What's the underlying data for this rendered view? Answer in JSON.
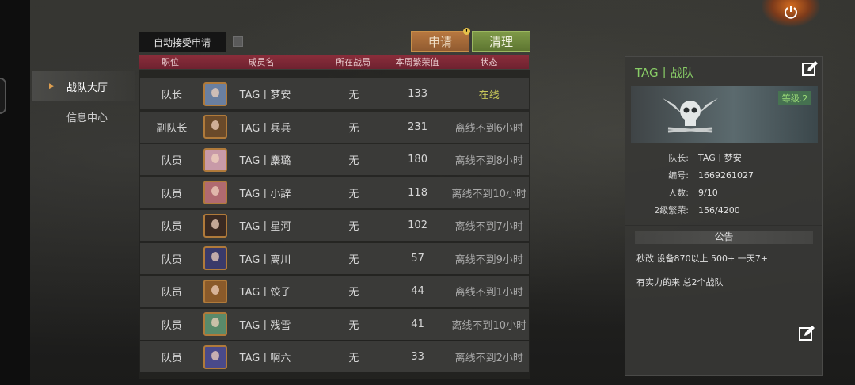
{
  "nav": {
    "items": [
      {
        "label": "战队大厅",
        "active": true
      },
      {
        "label": "信息中心",
        "active": false
      }
    ]
  },
  "toolbar": {
    "auto_accept_label": "自动接受申请",
    "apply_label": "申请",
    "apply_badge": "!",
    "clear_label": "清理"
  },
  "table": {
    "headers": [
      "职位",
      "成员名",
      "所在战局",
      "本周繁荣值",
      "状态"
    ],
    "rows": [
      {
        "role": "队长",
        "name": "TAG丨梦安",
        "battle": "无",
        "prosperity": "133",
        "status": "在线",
        "online": true
      },
      {
        "role": "副队长",
        "name": "TAG丨兵兵",
        "battle": "无",
        "prosperity": "231",
        "status": "离线不到6小时",
        "online": false
      },
      {
        "role": "队员",
        "name": "TAG丨麋璐",
        "battle": "无",
        "prosperity": "180",
        "status": "离线不到8小时",
        "online": false
      },
      {
        "role": "队员",
        "name": "TAG丨小辞",
        "battle": "无",
        "prosperity": "118",
        "status": "离线不到10小时",
        "online": false
      },
      {
        "role": "队员",
        "name": "TAG丨星河",
        "battle": "无",
        "prosperity": "102",
        "status": "离线不到7小时",
        "online": false
      },
      {
        "role": "队员",
        "name": "TAG丨离川",
        "battle": "无",
        "prosperity": "57",
        "status": "离线不到9小时",
        "online": false
      },
      {
        "role": "队员",
        "name": "TAG丨饺子",
        "battle": "无",
        "prosperity": "44",
        "status": "离线不到1小时",
        "online": false
      },
      {
        "role": "队员",
        "name": "TAG丨残雪",
        "battle": "无",
        "prosperity": "41",
        "status": "离线不到10小时",
        "online": false
      },
      {
        "role": "队员",
        "name": "TAG丨啊六",
        "battle": "无",
        "prosperity": "33",
        "status": "离线不到2小时",
        "online": false
      }
    ]
  },
  "team": {
    "title": "TAG丨战队",
    "level": "等级.2",
    "info": [
      {
        "key": "队长:",
        "value": "TAG丨梦安"
      },
      {
        "key": "编号:",
        "value": "1669261027"
      },
      {
        "key": "人数:",
        "value": "9/10"
      },
      {
        "key": "2级繁荣:",
        "value": "156/4200"
      }
    ],
    "notice_title": "公告",
    "notice_lines": [
      "秒改 设备870以上 500+ 一天7+",
      "有实力的来 总2个战队"
    ]
  },
  "colors": {
    "online": "#c8c85a",
    "offline": "#a8a8a8",
    "header_red": "#8a2d3a",
    "accent_green": "#88cc66"
  },
  "icons": {
    "power": "power-icon",
    "edit": "edit-icon",
    "nav_arrow": "triangle-right-icon"
  }
}
